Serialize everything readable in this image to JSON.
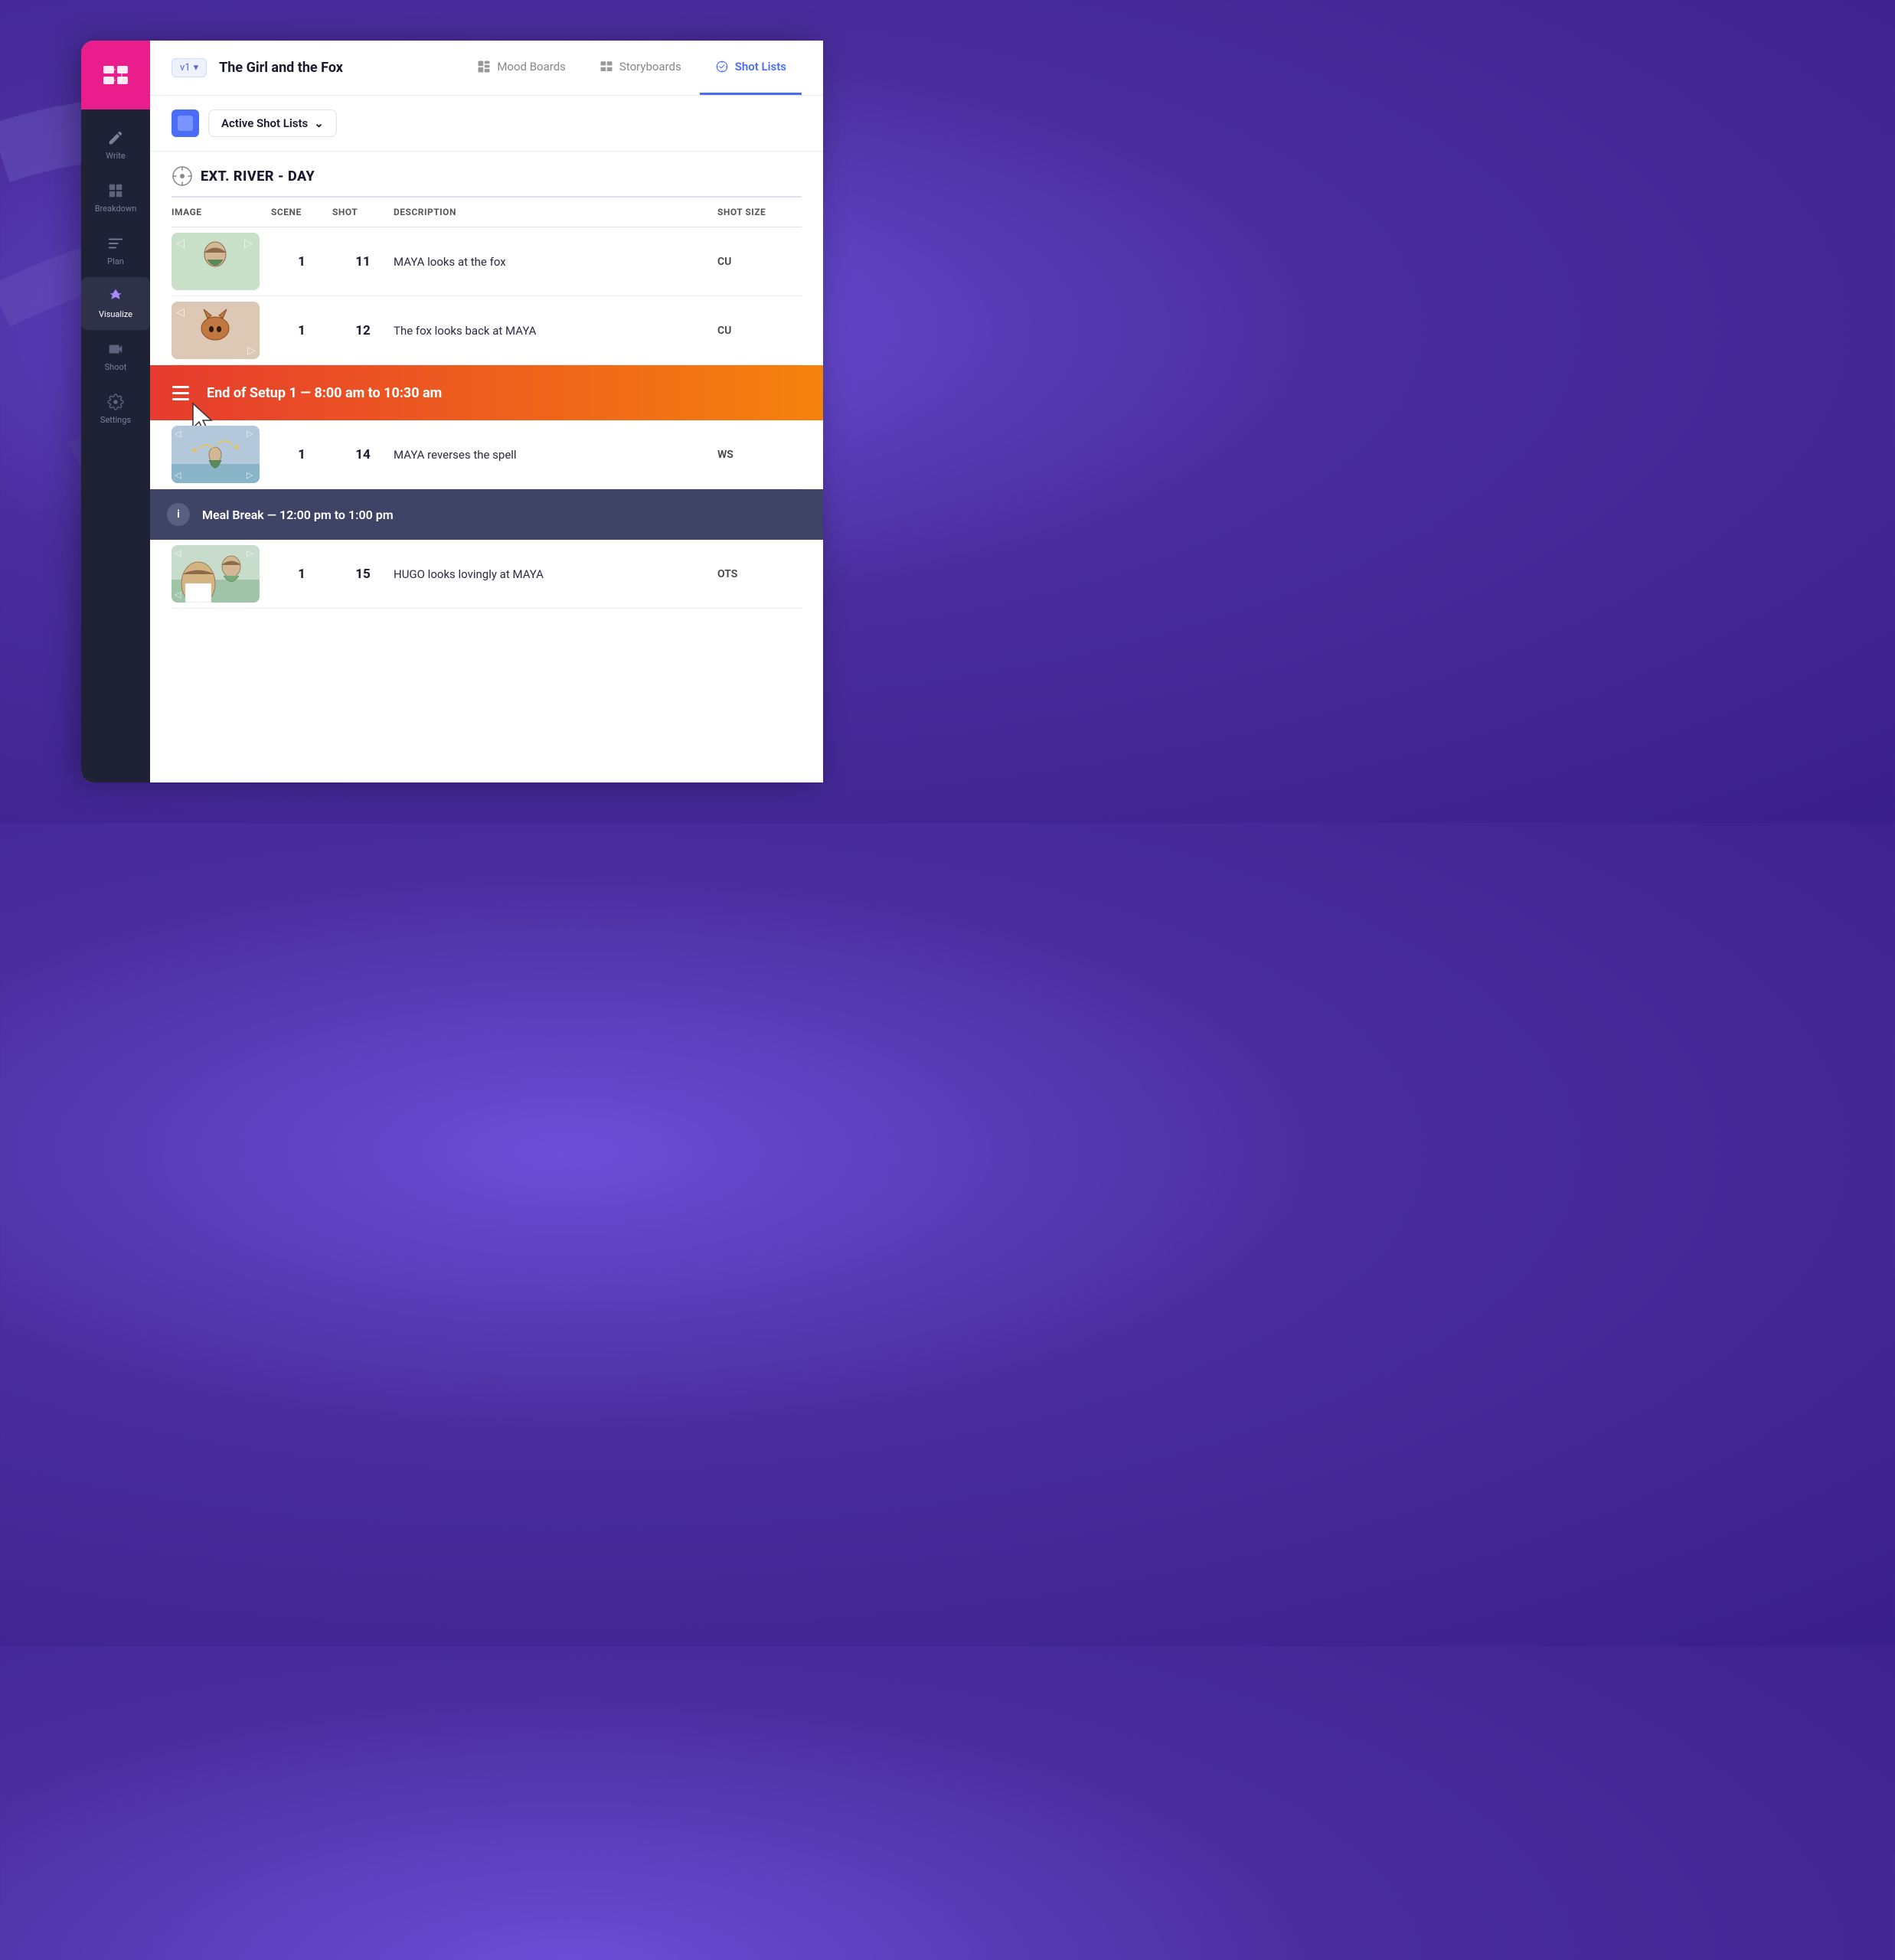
{
  "sidebar": {
    "logo_label": "Logo",
    "items": [
      {
        "id": "write",
        "label": "Write",
        "active": false
      },
      {
        "id": "breakdown",
        "label": "Breakdown",
        "active": false
      },
      {
        "id": "plan",
        "label": "Plan",
        "active": false
      },
      {
        "id": "visualize",
        "label": "Visualize",
        "active": true
      },
      {
        "id": "shoot",
        "label": "Shoot",
        "active": false
      },
      {
        "id": "settings",
        "label": "Settings",
        "active": false
      }
    ]
  },
  "topbar": {
    "version": "v1",
    "version_chevron": "▾",
    "project_title": "The Girl and the Fox",
    "nav_items": [
      {
        "id": "mood-boards",
        "label": "Mood Boards",
        "active": false
      },
      {
        "id": "storyboards",
        "label": "Storyboards",
        "active": false
      },
      {
        "id": "shot-lists",
        "label": "Shot Lists",
        "active": true
      }
    ]
  },
  "filter": {
    "label": "Active Shot Lists",
    "chevron": "⌄"
  },
  "scene": {
    "title": "EXT. RIVER - DAY",
    "table_headers": [
      "IMAGE",
      "SCENE",
      "SHOT",
      "DESCRIPTION",
      "SHOT SIZE"
    ],
    "rows": [
      {
        "id": "row-1",
        "scene": "1",
        "shot": "11",
        "description": "MAYA looks at the fox",
        "shot_size": "CU",
        "sketch_class": "sketch-maya-fox"
      },
      {
        "id": "row-2",
        "scene": "1",
        "shot": "12",
        "description": "The fox looks back at MAYA",
        "shot_size": "CU",
        "sketch_class": "sketch-fox"
      }
    ],
    "setup_banner": {
      "text": "End of Setup 1 — 8:00 am to 10:30 am"
    },
    "rows_after_setup": [
      {
        "id": "row-3",
        "scene": "1",
        "shot": "14",
        "description": "MAYA reverses the spell",
        "shot_size": "WS",
        "sketch_class": "sketch-spell"
      }
    ],
    "meal_break": {
      "text": "Meal Break — 12:00 pm to 1:00 pm"
    },
    "rows_after_meal": [
      {
        "id": "row-4",
        "scene": "1",
        "shot": "15",
        "description": "HUGO looks lovingly at MAYA",
        "shot_size": "OTS",
        "sketch_class": "sketch-hugo"
      }
    ]
  }
}
